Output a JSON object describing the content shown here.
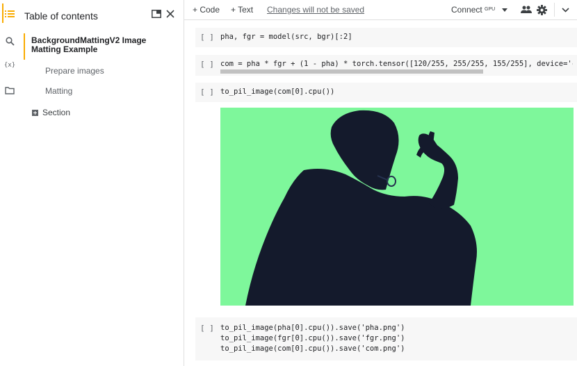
{
  "toc": {
    "title": "Table of contents",
    "heading": "BackgroundMattingV2 Image Matting Example",
    "items": [
      "Prepare images",
      "Matting"
    ],
    "section_label": "Section"
  },
  "rail": {
    "icons": [
      "toc-icon",
      "search-icon",
      "variables-icon",
      "files-icon"
    ],
    "variables_label": "{x}"
  },
  "toolbar": {
    "add_code": "+ Code",
    "add_text": "+ Text",
    "unsaved": "Changes will not be saved",
    "connect": "Connect",
    "gpu": "GPU"
  },
  "cells": [
    {
      "run_label": "[ ]",
      "lines": [
        "pha, fgr = model(src, bgr)[:2]"
      ]
    },
    {
      "run_label": "[ ]",
      "lines": [
        "com = pha * fgr + (1 - pha) * torch.tensor([120/255, 255/255, 155/255], device='cuda"
      ]
    },
    {
      "run_label": "[ ]",
      "lines": [
        "to_pil_image(com[0].cpu())"
      ]
    },
    {
      "run_label": "[ ]",
      "lines": [
        "to_pil_image(pha[0].cpu()).save('pha.png')",
        "to_pil_image(fgr[0].cpu()).save('fgr.png')",
        "to_pil_image(com[0].cpu()).save('com.png')"
      ]
    }
  ],
  "colors": {
    "accent": "#f9ab00",
    "output_background": "#7ef79b",
    "silhouette": "#141a2c"
  }
}
